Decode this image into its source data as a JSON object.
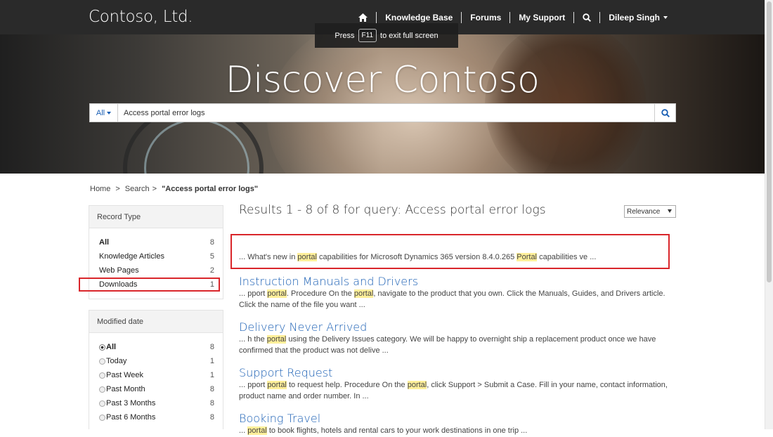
{
  "header": {
    "brand": "Contoso, Ltd.",
    "nav": [
      {
        "label": "Knowledge Base"
      },
      {
        "label": "Forums"
      },
      {
        "label": "My Support"
      }
    ],
    "user": "Dileep Singh"
  },
  "toast": {
    "press": "Press",
    "key": "F11",
    "rest": "to exit full screen"
  },
  "hero": {
    "title": "Discover Contoso"
  },
  "search": {
    "filter": "All",
    "value": "Access portal error logs"
  },
  "breadcrumb": {
    "home": "Home",
    "sep1": ">",
    "search": "Search",
    "sep2": ">",
    "current": "\"Access portal error logs\""
  },
  "record_type": {
    "title": "Record Type",
    "items": [
      {
        "label": "All",
        "count": "8"
      },
      {
        "label": "Knowledge Articles",
        "count": "5"
      },
      {
        "label": "Web Pages",
        "count": "2"
      },
      {
        "label": "Downloads",
        "count": "1"
      }
    ]
  },
  "modified": {
    "title": "Modified date",
    "items": [
      {
        "label": "All",
        "count": "8"
      },
      {
        "label": "Today",
        "count": "1"
      },
      {
        "label": "Past Week",
        "count": "1"
      },
      {
        "label": "Past Month",
        "count": "8"
      },
      {
        "label": "Past 3 Months",
        "count": "8"
      },
      {
        "label": "Past 6 Months",
        "count": "8"
      }
    ]
  },
  "results": {
    "summary": "Results 1 - 8 of 8 for query: Access portal error logs",
    "sort": "Relevance",
    "items": [
      {
        "title": "",
        "snippet": [
          [
            "... What's new in ",
            false
          ],
          [
            "portal",
            true
          ],
          [
            " capabilities for Microsoft Dynamics 365 version 8.4.0.265 ",
            false
          ],
          [
            "Portal",
            true
          ],
          [
            " capabilities ve ...",
            false
          ]
        ]
      },
      {
        "title": "Instruction Manuals and Drivers",
        "snippet": [
          [
            "... pport ",
            false
          ],
          [
            "portal",
            true
          ],
          [
            ". Procedure On the ",
            false
          ],
          [
            "portal",
            true
          ],
          [
            ", navigate to the product that you own. Click the Manuals, Guides, and Drivers article. Click the name of the file you want ...",
            false
          ]
        ]
      },
      {
        "title": "Delivery Never Arrived",
        "snippet": [
          [
            "... h the ",
            false
          ],
          [
            "portal",
            true
          ],
          [
            " using the Delivery Issues category. We will be happy to overnight ship a replacement product once we have confirmed that the product was not delive ...",
            false
          ]
        ]
      },
      {
        "title": "Support Request",
        "snippet": [
          [
            "... pport ",
            false
          ],
          [
            "portal",
            true
          ],
          [
            " to request help. Procedure On the ",
            false
          ],
          [
            "portal",
            true
          ],
          [
            ", click Support > Submit a Case. Fill in your name, contact information, product name and order number. In ...",
            false
          ]
        ]
      },
      {
        "title": "Booking Travel",
        "snippet": [
          [
            "... ",
            false
          ],
          [
            "portal",
            true
          ],
          [
            " to book flights, hotels and rental cars to your work destinations in one trip ...",
            false
          ]
        ]
      }
    ]
  },
  "colors": {
    "accent": "#1a5fb4",
    "highlight": "#ffef9a",
    "annotation": "#d9262b",
    "topbar": "#2a2a2a"
  }
}
